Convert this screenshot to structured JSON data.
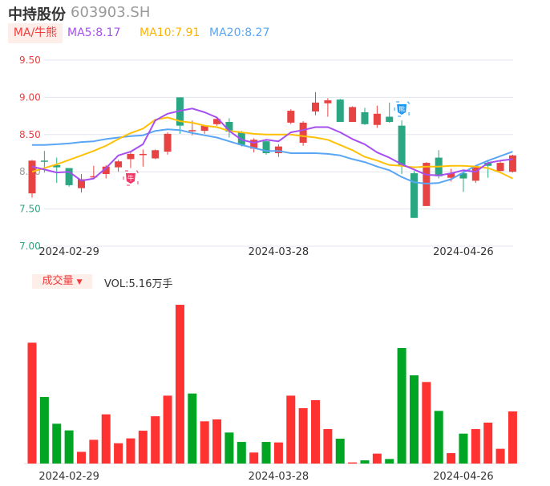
{
  "header": {
    "name": "中持股份",
    "code": "603903.SH"
  },
  "indicator": {
    "tag": "MA/牛熊",
    "ma5": "MA5:8.17",
    "ma10": "MA10:7.91",
    "ma20": "MA20:8.27"
  },
  "volume_panel": {
    "tag": "成交量",
    "tag_arrow": "▼",
    "value": "VOL:5.16万手"
  },
  "colors": {
    "up": "#e84343",
    "down": "#2aa683",
    "vol_up": "#ff3232",
    "vol_down": "#00a524",
    "ma5": "#a64ff0",
    "ma10": "#ffc107",
    "ma20": "#5aa6f5",
    "grid": "#e3e6ef"
  },
  "chart_data": [
    {
      "type": "candlestick",
      "title": "中持股份 603903.SH",
      "ylim": [
        7.0,
        9.5
      ],
      "y_ticks": [
        "9.50",
        "9.00",
        "8.50",
        "8.00",
        "7.50",
        "7.00"
      ],
      "x_tick_labels": [
        {
          "index": 3,
          "label": "2024-02-29"
        },
        {
          "index": 20,
          "label": "2024-03-28"
        },
        {
          "index": 35,
          "label": "2024-04-26"
        }
      ],
      "ohlc": [
        [
          7.71,
          8.16,
          7.65,
          8.15
        ],
        [
          8.15,
          8.28,
          7.99,
          8.14
        ],
        [
          8.09,
          8.19,
          7.85,
          8.06
        ],
        [
          8.05,
          8.05,
          7.8,
          7.82
        ],
        [
          7.78,
          7.97,
          7.72,
          7.9
        ],
        [
          7.93,
          8.08,
          7.91,
          7.94
        ],
        [
          7.97,
          8.09,
          7.91,
          8.07
        ],
        [
          8.06,
          8.16,
          8.0,
          8.14
        ],
        [
          8.17,
          8.26,
          8.05,
          8.24
        ],
        [
          8.24,
          8.3,
          8.07,
          8.24
        ],
        [
          8.18,
          8.3,
          8.17,
          8.29
        ],
        [
          8.27,
          8.53,
          8.23,
          8.51
        ],
        [
          9.0,
          9.0,
          8.51,
          8.62
        ],
        [
          8.55,
          8.69,
          8.49,
          8.56
        ],
        [
          8.55,
          8.63,
          8.51,
          8.62
        ],
        [
          8.64,
          8.72,
          8.62,
          8.71
        ],
        [
          8.67,
          8.72,
          8.46,
          8.54
        ],
        [
          8.53,
          8.55,
          8.34,
          8.36
        ],
        [
          8.31,
          8.45,
          8.26,
          8.43
        ],
        [
          8.41,
          8.43,
          8.23,
          8.25
        ],
        [
          8.25,
          8.37,
          8.2,
          8.34
        ],
        [
          8.66,
          8.84,
          8.64,
          8.82
        ],
        [
          8.39,
          8.68,
          8.35,
          8.66
        ],
        [
          8.81,
          9.07,
          8.76,
          8.93
        ],
        [
          8.92,
          8.99,
          8.74,
          8.96
        ],
        [
          8.97,
          8.98,
          8.67,
          8.67
        ],
        [
          8.67,
          8.88,
          8.67,
          8.87
        ],
        [
          8.8,
          8.86,
          8.63,
          8.64
        ],
        [
          8.63,
          8.89,
          8.59,
          8.78
        ],
        [
          8.74,
          8.93,
          8.66,
          8.67
        ],
        [
          8.62,
          8.69,
          7.97,
          8.08
        ],
        [
          7.98,
          8.01,
          7.38,
          7.38
        ],
        [
          7.54,
          8.13,
          7.54,
          8.12
        ],
        [
          8.19,
          8.29,
          7.91,
          7.94
        ],
        [
          7.92,
          8.04,
          7.87,
          7.98
        ],
        [
          7.98,
          8.02,
          7.73,
          7.91
        ],
        [
          7.88,
          8.08,
          7.85,
          8.06
        ],
        [
          8.12,
          8.14,
          7.92,
          8.08
        ],
        [
          8.01,
          8.14,
          8.01,
          8.12
        ],
        [
          8.0,
          8.23,
          7.99,
          8.22
        ]
      ],
      "ohlc_fields": [
        "open",
        "high",
        "low",
        "close"
      ],
      "series": [
        {
          "name": "MA5",
          "values": [
            8.07,
            8.03,
            7.99,
            8.0,
            7.88,
            7.91,
            8.05,
            8.22,
            8.27,
            8.37,
            8.69,
            8.78,
            8.82,
            8.85,
            8.8,
            8.73,
            8.55,
            8.43,
            8.39,
            8.43,
            8.41,
            8.53,
            8.56,
            8.6,
            8.6,
            8.53,
            8.44,
            8.37,
            8.26,
            8.19,
            8.1,
            8.03,
            7.96,
            7.95,
            7.98,
            8.02,
            8.0,
            8.12,
            8.15,
            8.17
          ]
        },
        {
          "name": "MA10",
          "values": [
            8.0,
            8.05,
            8.1,
            8.16,
            8.22,
            8.28,
            8.35,
            8.44,
            8.52,
            8.58,
            8.7,
            8.73,
            8.68,
            8.66,
            8.62,
            8.6,
            8.55,
            8.53,
            8.51,
            8.5,
            8.5,
            8.5,
            8.48,
            8.46,
            8.43,
            8.36,
            8.29,
            8.2,
            8.15,
            8.09,
            8.08,
            8.06,
            8.07,
            8.07,
            8.08,
            8.08,
            8.07,
            8.05,
            7.99,
            7.91
          ]
        },
        {
          "name": "MA20",
          "values": [
            8.36,
            8.36,
            8.37,
            8.38,
            8.4,
            8.41,
            8.44,
            8.46,
            8.48,
            8.49,
            8.55,
            8.57,
            8.56,
            8.52,
            8.49,
            8.46,
            8.41,
            8.36,
            8.32,
            8.28,
            8.28,
            8.25,
            8.25,
            8.25,
            8.24,
            8.22,
            8.17,
            8.13,
            8.07,
            8.02,
            7.93,
            7.86,
            7.84,
            7.85,
            7.9,
            7.99,
            8.08,
            8.15,
            8.21,
            8.27
          ]
        }
      ],
      "markers": [
        {
          "index": 8,
          "type": "bull",
          "label": "牛"
        },
        {
          "index": 30,
          "type": "bear",
          "label": "熊"
        }
      ]
    },
    {
      "type": "bar",
      "title": "成交量",
      "unit": "万手",
      "values": [
        11.96,
        6.59,
        3.94,
        3.28,
        1.16,
        2.35,
        4.87,
        2.01,
        2.49,
        3.25,
        4.68,
        6.72,
        15.71,
        6.93,
        4.18,
        4.37,
        3.07,
        2.14,
        1.09,
        2.14,
        2.09,
        6.72,
        5.48,
        6.27,
        3.41,
        2.46,
        0.11,
        0.32,
        0.98,
        0.45,
        11.43,
        8.73,
        8.07,
        5.21,
        1.03,
        2.96,
        3.41,
        4.05,
        1.46,
        5.16
      ],
      "directions": [
        "up",
        "down",
        "down",
        "down",
        "up",
        "up",
        "up",
        "up",
        "up",
        "up",
        "up",
        "up",
        "up",
        "down",
        "up",
        "up",
        "down",
        "down",
        "up",
        "down",
        "up",
        "up",
        "up",
        "up",
        "up",
        "down",
        "up",
        "down",
        "up",
        "down",
        "down",
        "down",
        "up",
        "down",
        "up",
        "down",
        "up",
        "up",
        "up",
        "up"
      ]
    }
  ]
}
